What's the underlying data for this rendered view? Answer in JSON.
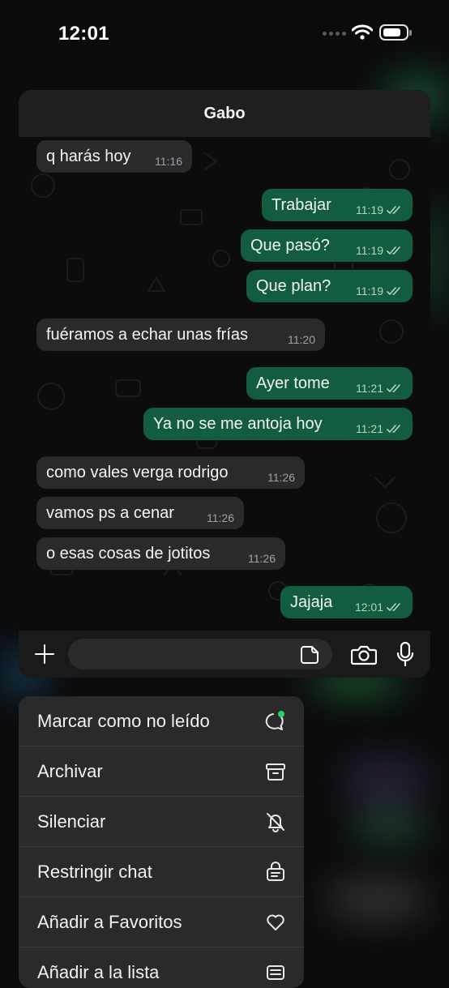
{
  "status_bar": {
    "time": "12:01"
  },
  "chat": {
    "contact_name": "Gabo",
    "messages": [
      {
        "direction": "in",
        "text": "q harás hoy",
        "time": "11:16"
      },
      {
        "direction": "out",
        "text": "Trabajar",
        "time": "11:19",
        "read": true
      },
      {
        "direction": "out",
        "text": "Que pasó?",
        "time": "11:19",
        "read": true
      },
      {
        "direction": "out",
        "text": "Que plan?",
        "time": "11:19",
        "read": true
      },
      {
        "direction": "in",
        "text": "fuéramos a echar unas frías",
        "time": "11:20"
      },
      {
        "direction": "out",
        "text": "Ayer tome",
        "time": "11:21",
        "read": true
      },
      {
        "direction": "out",
        "text": "Ya no se me antoja hoy",
        "time": "11:21",
        "read": true
      },
      {
        "direction": "in",
        "text": "como vales verga rodrigo",
        "time": "11:26"
      },
      {
        "direction": "in",
        "text": "vamos ps a cenar",
        "time": "11:26"
      },
      {
        "direction": "in",
        "text": "o esas cosas de jotitos",
        "time": "11:26"
      },
      {
        "direction": "out",
        "text": "Jajaja",
        "time": "12:01",
        "read": true
      }
    ],
    "input": {
      "value": "",
      "placeholder": ""
    }
  },
  "context_menu": {
    "items": [
      {
        "label": "Marcar como no leído",
        "icon": "unread-chat-icon"
      },
      {
        "label": "Archivar",
        "icon": "archive-icon"
      },
      {
        "label": "Silenciar",
        "icon": "mute-bell-icon"
      },
      {
        "label": "Restringir chat",
        "icon": "lock-chat-icon"
      },
      {
        "label": "Añadir a Favoritos",
        "icon": "heart-icon"
      },
      {
        "label": "Añadir a la lista",
        "icon": "list-icon"
      }
    ]
  },
  "colors": {
    "outgoing_bubble": "#125c40",
    "incoming_bubble": "#2a2a2c",
    "unread_dot": "#25d366"
  }
}
